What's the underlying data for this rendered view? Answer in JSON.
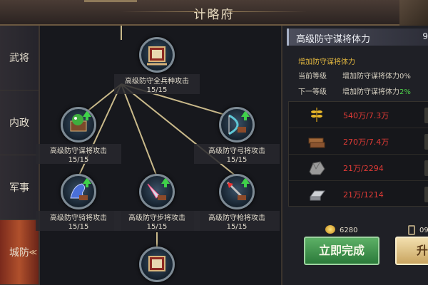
{
  "header": {
    "title": "计略府"
  },
  "nav": {
    "items": [
      {
        "label": "武将"
      },
      {
        "label": "内政"
      },
      {
        "label": "军事"
      },
      {
        "label": "城防"
      }
    ],
    "active_index": 3,
    "active_arrow": "≪"
  },
  "tree": {
    "nodes": [
      {
        "label": "高级防守全兵种攻击",
        "count": "15/15",
        "icon": "banner-scroll-icon"
      },
      {
        "label": "高级防守谋将攻击",
        "count": "15/15",
        "icon": "spellbook-icon"
      },
      {
        "label": "高级防守弓将攻击",
        "count": "15/15",
        "icon": "bow-icon"
      },
      {
        "label": "高级防守骑将攻击",
        "count": "15/15",
        "icon": "horse-icon"
      },
      {
        "label": "高级防守步将攻击",
        "count": "15/15",
        "icon": "blade-icon"
      },
      {
        "label": "高级防守枪将攻击",
        "count": "15/15",
        "icon": "spear-icon"
      },
      {
        "label": "",
        "count": "",
        "icon": "banner-scroll-icon"
      }
    ]
  },
  "panel": {
    "skill_name": "高级防守谋将体力",
    "skill_name_cut": "9",
    "effect_title": "增加防守谋将体力",
    "current_label": "当前等级",
    "current_value": "增加防守谋将体力0%",
    "next_label": "下一等级",
    "next_value_prefix": "增加防守谋将体力",
    "next_value_pct": "2%",
    "costs": [
      {
        "icon": "grain-icon",
        "text": "540万/7.3万"
      },
      {
        "icon": "wood-icon",
        "text": "270万/7.4万"
      },
      {
        "icon": "stone-icon",
        "text": "21万/2294"
      },
      {
        "icon": "iron-icon",
        "text": "21万/1214"
      }
    ],
    "gold_amount": "6280",
    "time_value": "09",
    "finish_button": "立即完成",
    "upgrade_button": "升"
  },
  "colors": {
    "cost_text": "#e23b36",
    "next_pct": "#4fd34b",
    "effect_title": "#e1b63f",
    "finish_button": "#2b7a3a",
    "nav_active": "#b0502c"
  }
}
